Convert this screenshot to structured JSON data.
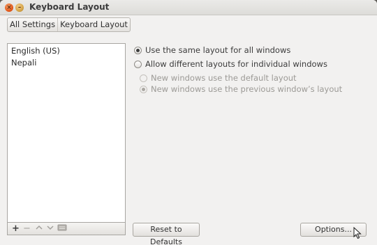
{
  "window": {
    "title": "Keyboard Layout"
  },
  "breadcrumb": {
    "items": [
      "All Settings",
      "Keyboard Layout"
    ]
  },
  "layouts": {
    "items": [
      "English (US)",
      "Nepali"
    ]
  },
  "list_toolbar": {
    "add": "+",
    "remove": "−",
    "up": "^",
    "down": "v"
  },
  "options": {
    "same_layout": "Use the same layout for all windows",
    "different_layouts": "Allow different layouts for individual windows",
    "new_default": "New windows use the default layout",
    "new_previous": "New windows use the previous window’s layout"
  },
  "buttons": {
    "reset": "Reset to Defaults",
    "options": "Options..."
  },
  "icons": {
    "close": "close-icon",
    "minimize": "minimize-icon",
    "keyboard": "keyboard-icon",
    "cursor": "mouse-pointer-icon"
  }
}
